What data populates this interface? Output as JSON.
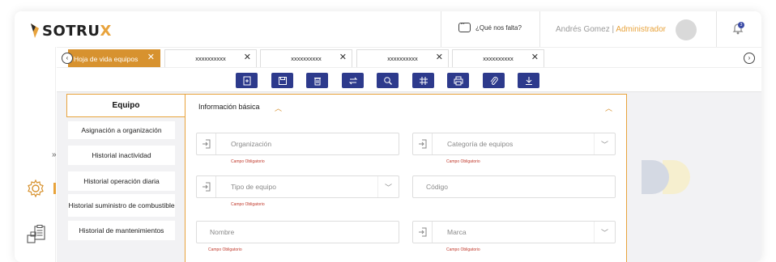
{
  "header": {
    "logo_text_main": "SOTRU",
    "logo_text_x": "X",
    "help_label": "¿Qué nos falta?",
    "user_name": "Andrés Gomez",
    "separator": " | ",
    "user_role": "Administrador",
    "notification_count": "3"
  },
  "tabs": [
    {
      "label": "Hoja de vida equipos",
      "active": true
    },
    {
      "label": "xxxxxxxxxx"
    },
    {
      "label": "xxxxxxxxxx"
    },
    {
      "label": "xxxxxxxxxx"
    },
    {
      "label": "xxxxxxxxxx"
    }
  ],
  "toolbar": {
    "buttons": [
      "add-icon",
      "save-icon",
      "delete-icon",
      "exchange-icon",
      "search-icon",
      "grid-icon",
      "print-icon",
      "attach-icon",
      "download-icon"
    ]
  },
  "menu": {
    "head": "Equipo",
    "items": [
      "Asignación a organización",
      "Historial inactividad",
      "Historial operación diaria",
      "Historial suministro de combustible",
      "Historial de mantenimientos"
    ]
  },
  "panel": {
    "title": "Información básica",
    "fields": [
      {
        "placeholder": "Organización",
        "required": "Campo Obligatorio"
      },
      {
        "placeholder": "Categoría de equipos",
        "required": "Campo Obligatorio"
      },
      {
        "placeholder": "Tipo de equipo",
        "required": "Campo Obligatorio"
      },
      {
        "placeholder": "Código",
        "required": ""
      },
      {
        "placeholder": "Nombre",
        "required": "Campo Obligatorio"
      },
      {
        "placeholder": "Marca",
        "required": "Campo Obligatorio"
      }
    ]
  },
  "colors": {
    "accent": "#e8a33c",
    "toolbar": "#2d3a8c",
    "required": "#c0392b"
  }
}
